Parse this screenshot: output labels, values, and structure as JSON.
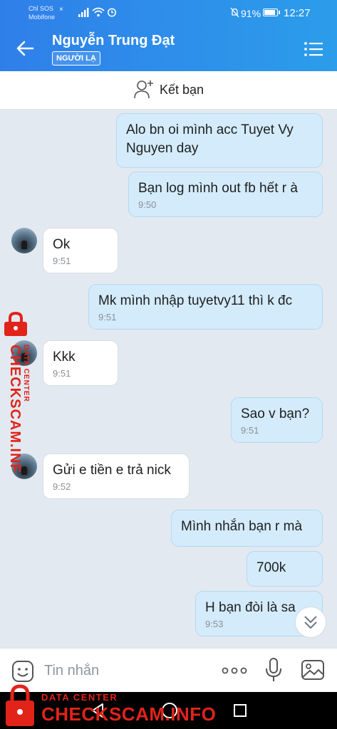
{
  "status_bar": {
    "carrier_line1": "Chỉ SOS",
    "carrier_line2": "Mobifone",
    "battery_pct": "91%",
    "battery_level": 0.91,
    "time": "12:27"
  },
  "header": {
    "contact_name": "Nguyễn Trung Đạt",
    "badge": "NGƯỜI LẠ"
  },
  "add_friend": {
    "label": "Kết bạn"
  },
  "messages": [
    {
      "dir": "out",
      "text": "Alo bn oi mình acc Tuyet Vy Nguyen day",
      "time": ""
    },
    {
      "dir": "out",
      "text": "Bạn log mình out fb hết r à",
      "time": "9:50"
    },
    {
      "dir": "in",
      "text": "Ok",
      "time": "9:51"
    },
    {
      "dir": "out",
      "text": "Mk mình nhập tuyetvy11 thì k đc",
      "time": "9:51"
    },
    {
      "dir": "in",
      "text": "Kkk",
      "time": "9:51"
    },
    {
      "dir": "out",
      "text": "Sao v bạn?",
      "time": "9:51"
    },
    {
      "dir": "in",
      "text": "Gửi e tiền e trả nick",
      "time": "9:52"
    },
    {
      "dir": "out",
      "text": "Mình nhắn bạn r mà",
      "time": ""
    },
    {
      "dir": "out",
      "text": "700k",
      "time": ""
    },
    {
      "dir": "out",
      "text": "H bạn đòi là sa",
      "time": "9:53"
    }
  ],
  "input": {
    "placeholder": "Tin nhắn"
  },
  "watermark": {
    "side_small": "DATA CENTER",
    "side_big": "CHECKSCAM.INFO",
    "bottom_small": "DATA CENTER",
    "bottom_big": "CHECKSCAM.INFO",
    "color": "#e2231a"
  },
  "colors": {
    "header_accent": "#2f7fe9",
    "outgoing_bubble": "#d3ebfb",
    "incoming_bubble": "#ffffff",
    "chat_background": "#e2e9f1"
  },
  "icons": [
    "back-arrow-icon",
    "list-menu-icon",
    "add-user-icon",
    "emoji-icon",
    "more-dots-icon",
    "microphone-icon",
    "image-icon",
    "chevron-double-down-icon",
    "nav-back-icon",
    "nav-home-icon",
    "nav-recent-icon",
    "lock-icon"
  ]
}
